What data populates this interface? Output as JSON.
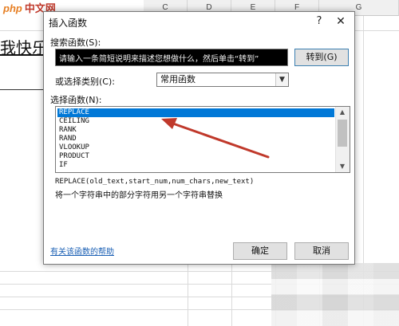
{
  "watermark": {
    "php": "php",
    "cn": "中文网"
  },
  "sheet": {
    "columns": [
      "C",
      "D",
      "E",
      "F",
      "G"
    ],
    "cell_text": "我快乐"
  },
  "dialog": {
    "title": "插入函数",
    "help_glyph": "?",
    "close_glyph": "✕",
    "search": {
      "label": "搜索函数(S):",
      "value": "请输入一条简短说明来描述您想做什么，然后单击“转到”"
    },
    "go_label": "转到(G)",
    "category": {
      "label": "或选择类别(C):",
      "value": "常用函数"
    },
    "list_label": "选择函数(N):",
    "functions": [
      "REPLACE",
      "CEILING",
      "RANK",
      "RAND",
      "VLOOKUP",
      "PRODUCT",
      "IF"
    ],
    "selected_index": 0,
    "syntax": "REPLACE(old_text,start_num,num_chars,new_text)",
    "description": "将一个字符串中的部分字符用另一个字符串替换",
    "help_link": "有关该函数的帮助",
    "ok_label": "确定",
    "cancel_label": "取消"
  },
  "colors": {
    "selection": "#0078d7",
    "arrow": "#c0392b",
    "link": "#1a5fb4"
  },
  "icons": {
    "select_arrow": "chevron-down-icon",
    "scroll_up": "chevron-up-icon",
    "scroll_down": "chevron-down-icon"
  }
}
